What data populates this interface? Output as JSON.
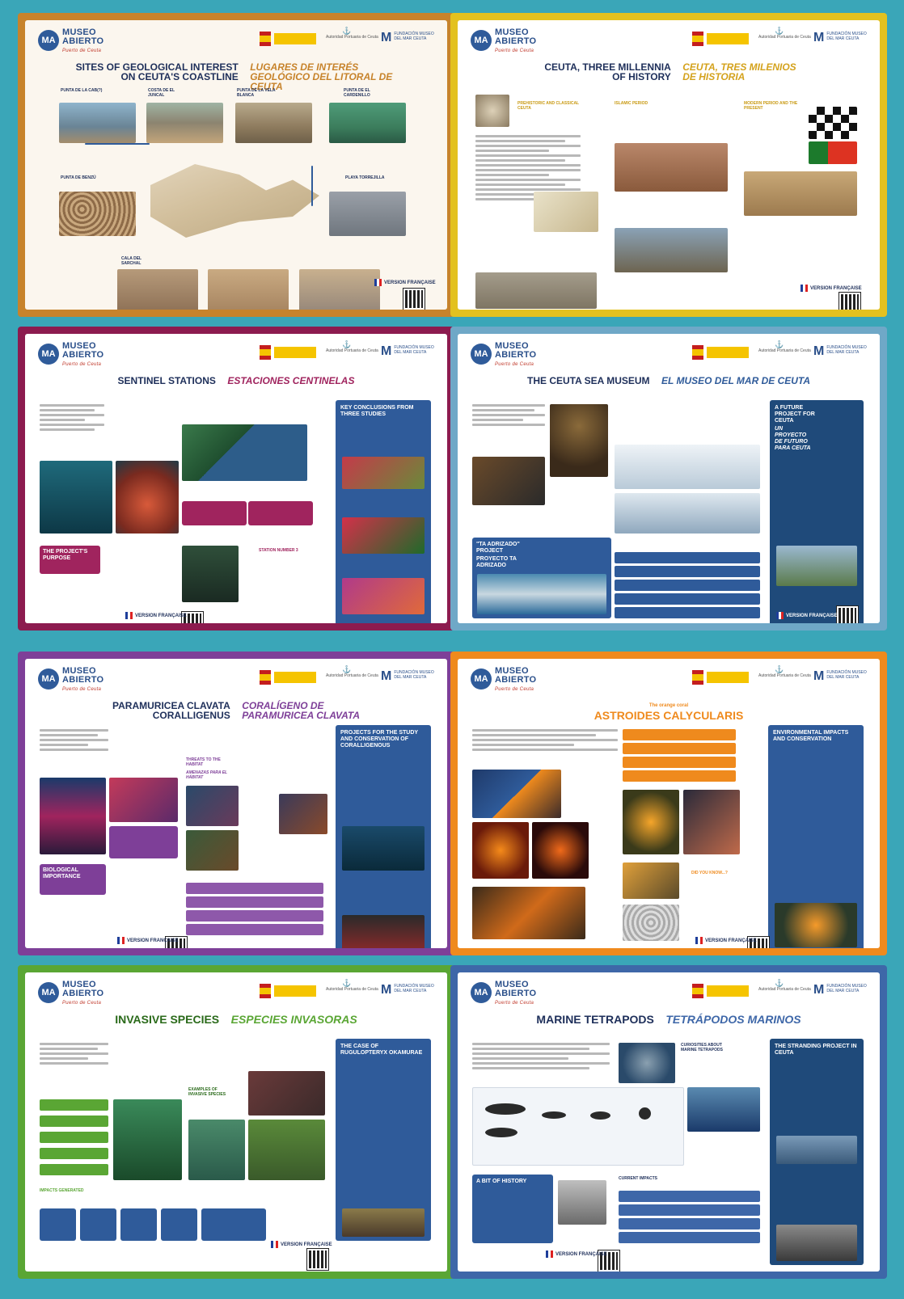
{
  "brand": {
    "name_line1": "MUSEO",
    "name_line2": "ABIERTO",
    "subtitle": "Puerto de Ceuta",
    "mark": "MA",
    "port_authority": "Autoridad Portuaria de Ceuta",
    "foundation_letter": "M",
    "foundation_text": "FUNDACIÓN MUSEO DEL MAR CEUTA",
    "french_version": "VERSION FRANÇAISE"
  },
  "panels": [
    {
      "id": "geological",
      "title_en": "SITES OF GEOLOGICAL INTEREST ON CEUTA'S COASTLINE",
      "title_es": "LUGARES DE INTERÉS GEOLÓGICO DEL LITORAL DE CEUTA",
      "frame_color": "#c7832b",
      "accent": "#c7832b",
      "labels": [
        "PUNTA DE LA CAB(?)",
        "COSTA DE EL JUNCAL",
        "PUNTA DE LA VELA BLANCA",
        "PUNTA DE EL CARDENILLO",
        "PUNTA DE BENZÚ",
        "PLAYA TORREJILLA",
        "CALA DEL SARCHAL"
      ]
    },
    {
      "id": "history",
      "title_en": "CEUTA, THREE MILLENNIA OF HISTORY",
      "title_es": "CEUTA, TRES MILENIOS DE HISTORIA",
      "frame_color": "#e3c11f",
      "accent": "#d4a21c",
      "labels": [
        "PREHISTORIC AND CLASSICAL CEUTA",
        "ISLAMIC PERIOD",
        "MODERN PERIOD AND THE PRESENT"
      ]
    },
    {
      "id": "sentinel",
      "title_en": "SENTINEL STATIONS",
      "title_es": "ESTACIONES CENTINELAS",
      "frame_color": "#8c1b4f",
      "accent": "#a0245e",
      "labels": [
        "THE PROJECT'S PURPOSE",
        "STATION NUMBER 3",
        "KEY CONCLUSIONS FROM THREE STUDIES"
      ]
    },
    {
      "id": "seamuseum",
      "title_en": "THE CEUTA SEA MUSEUM",
      "title_es": "EL MUSEO DEL MAR DE CEUTA",
      "frame_color": "#6fa8c7",
      "accent": "#2f5b9a",
      "labels": [
        "\"TA ADRIZADO\" PROJECT",
        "PROYECTO TA ADRIZADO",
        "A FUTURE PROJECT FOR CEUTA",
        "UN PROYECTO DE FUTURO PARA CEUTA"
      ]
    },
    {
      "id": "paramuricea",
      "title_en": "PARAMURICEA CLAVATA CORALLIGENUS",
      "title_es": "CORALÍGENO DE PARAMURICEA CLAVATA",
      "frame_color": "#7e3f98",
      "accent": "#7e3f98",
      "labels": [
        "THREATS TO THE HABITAT",
        "AMENAZAS PARA EL HÁBITAT",
        "BIOLOGICAL IMPORTANCE",
        "PROJECTS FOR THE STUDY AND CONSERVATION OF CORALLIGENOUS"
      ]
    },
    {
      "id": "astroides",
      "title_en": "The orange coral",
      "title_es": "ASTROIDES CALYCULARIS",
      "frame_color": "#ef8a1d",
      "accent": "#ef8a1d",
      "labels": [
        "ENVIRONMENTAL IMPACTS AND CONSERVATION",
        "DID YOU KNOW...?"
      ]
    },
    {
      "id": "invasive",
      "title_en": "INVASIVE SPECIES",
      "title_es": "ESPECIES INVASORAS",
      "frame_color": "#5aa634",
      "accent": "#4f9a2c",
      "labels": [
        "EXAMPLES OF INVASIVE SPECIES",
        "IMPACTS GENERATED",
        "THE CASE OF RUGULOPTERYX OKAMURAE"
      ]
    },
    {
      "id": "tetrapods",
      "title_en": "MARINE TETRAPODS",
      "title_es": "TETRÁPODOS MARINOS",
      "frame_color": "#3e67a8",
      "accent": "#3e67a8",
      "labels": [
        "CURIOSITIES ABOUT MARINE TETRAPODS",
        "A BIT OF HISTORY",
        "CURRENT IMPACTS",
        "THE STRANDING PROJECT IN CEUTA"
      ]
    }
  ]
}
